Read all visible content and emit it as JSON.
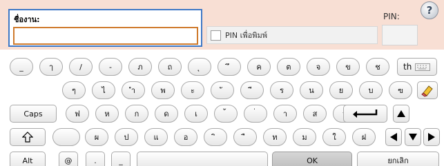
{
  "form": {
    "name_label": "ชื่องาน:",
    "name_value": "",
    "pin_checkbox_label": "PIN เพื่อพิมพ์",
    "pin_label": "PIN:",
    "help_symbol": "?"
  },
  "keyboard": {
    "row1": [
      "_",
      "ๅ",
      "/",
      "-",
      "ภ",
      "ถ",
      "ุ",
      "ึ",
      "ค",
      "ต",
      "จ",
      "ข",
      "ช"
    ],
    "row1_lang": "th",
    "row2": [
      "ๆ",
      "ไ",
      "ำ",
      "พ",
      "ะ",
      "ั",
      "ี",
      "ร",
      "น",
      "ย",
      "บ",
      "ล",
      "ฃ"
    ],
    "caps_label": "Caps",
    "row3": [
      "ฟ",
      "ห",
      "ก",
      "ด",
      "เ",
      "้",
      "่",
      "า",
      "ส",
      "ว",
      "ง"
    ],
    "row4": [
      "",
      "ผ",
      "ป",
      "แ",
      "อ",
      "ิ",
      "ื",
      "ท",
      "ม",
      "ใ",
      "ฝ"
    ],
    "alt_label": "Alt",
    "at_label": "@",
    "dot_label": ".",
    "underscore_label": "_",
    "ok_label": "OK",
    "cancel_label": "ยกเลิก"
  }
}
